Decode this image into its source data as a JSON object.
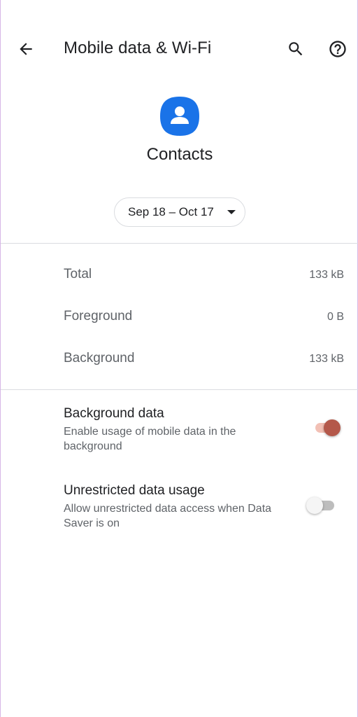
{
  "toolbar": {
    "title": "Mobile data & Wi-Fi",
    "back_icon": "arrow-back-icon",
    "search_icon": "search-icon",
    "help_icon": "help-icon"
  },
  "app": {
    "name": "Contacts",
    "icon": "contacts-icon",
    "icon_color": "#1a73e8"
  },
  "date_range": {
    "label": "Sep 18 – Oct 17",
    "icon": "dropdown-arrow-icon"
  },
  "usage": [
    {
      "label": "Total",
      "value": "133 kB"
    },
    {
      "label": "Foreground",
      "value": "0 B"
    },
    {
      "label": "Background",
      "value": "133 kB"
    }
  ],
  "preferences": [
    {
      "title": "Background data",
      "summary": "Enable usage of mobile data in the background",
      "enabled": true
    },
    {
      "title": "Unrestricted data usage",
      "summary": "Allow unrestricted data access when Data Saver is on",
      "enabled": false
    }
  ],
  "colors": {
    "accent": "#b4584a",
    "accent_track": "#f2c0b5",
    "primary_text": "#202124",
    "secondary_text": "#5f6368"
  }
}
